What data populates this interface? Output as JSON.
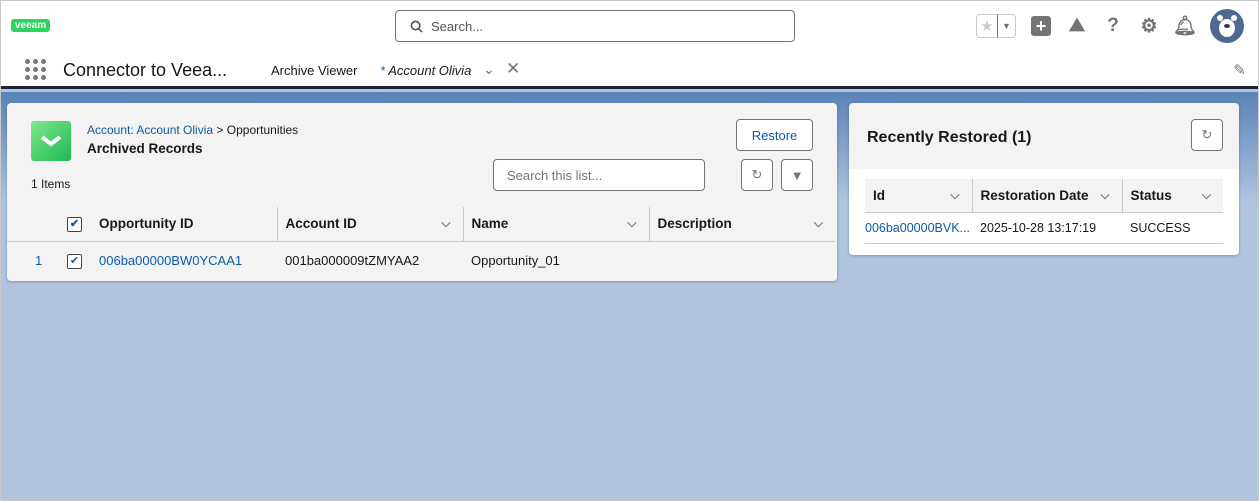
{
  "header": {
    "logo": "veeam",
    "search_placeholder": "Search..."
  },
  "nav": {
    "app_name": "Connector to Veea...",
    "tabs": [
      {
        "label": "Archive Viewer"
      },
      {
        "label": "Account Olivia",
        "prefix": "*"
      }
    ]
  },
  "archived": {
    "breadcrumb_link": "Account: Account Olivia",
    "breadcrumb_sep": ">",
    "breadcrumb_current": "Opportunities",
    "title": "Archived Records",
    "count": "1 Items",
    "restore_label": "Restore",
    "search_placeholder": "Search this list...",
    "columns": [
      "Opportunity ID",
      "Account ID",
      "Name",
      "Description"
    ],
    "rows": [
      {
        "num": "1",
        "opportunity_id": "006ba00000BW0YCAA1",
        "account_id": "001ba000009tZMYAA2",
        "name": "Opportunity_01",
        "description": ""
      }
    ]
  },
  "recent": {
    "title": "Recently Restored (1)",
    "columns": [
      "Id",
      "Restoration Date",
      "Status"
    ],
    "rows": [
      {
        "id": "006ba00000BVK...",
        "date": "2025-10-28 13:17:19",
        "status": "SUCCESS"
      }
    ]
  }
}
